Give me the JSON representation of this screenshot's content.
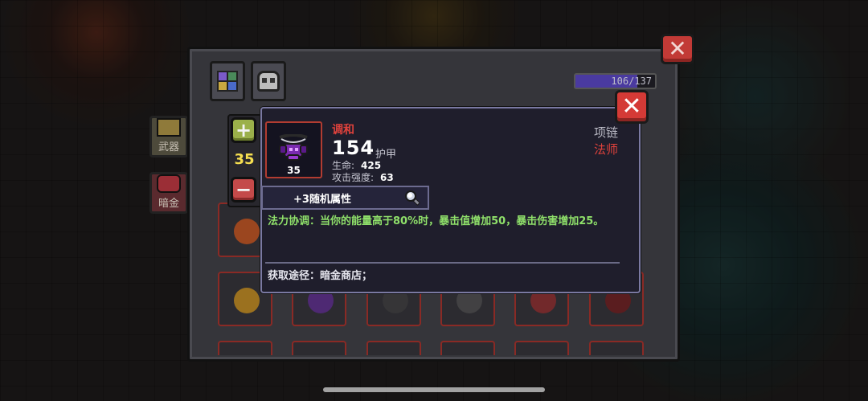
{
  "sidebar": {
    "tabs": [
      {
        "label": "武器",
        "icon": "weapon-icon"
      },
      {
        "label": "暗金",
        "icon": "dark-gold-icon"
      }
    ]
  },
  "inventory": {
    "filters": [
      {
        "icon": "all-categories-icon"
      },
      {
        "icon": "skull-mask-icon"
      }
    ],
    "capacity_text": "106/137",
    "capacity_fraction": 0.774,
    "close_icon": "close-icon"
  },
  "level_stepper": {
    "value": "35",
    "plus_icon": "plus-icon",
    "minus_icon": "minus-icon"
  },
  "item_tooltip": {
    "name": "调和",
    "level": "35",
    "main_stat_value": "154",
    "main_stat_label": "护甲",
    "attributes": [
      {
        "label": "生命:",
        "value": "425"
      },
      {
        "label": "攻击强度:",
        "value": "63"
      }
    ],
    "slot_type": "项链",
    "class": "法师",
    "random_attributes": "+3随机属性",
    "description": "法力协调：当你的能量高于80%时，暴击值增加50，暴击伤害增加25。",
    "source": "获取途径：暗金商店；",
    "colors": {
      "rarity": "#e0423c",
      "effect_text": "#8fe06a",
      "border": "#7a79a2"
    }
  }
}
